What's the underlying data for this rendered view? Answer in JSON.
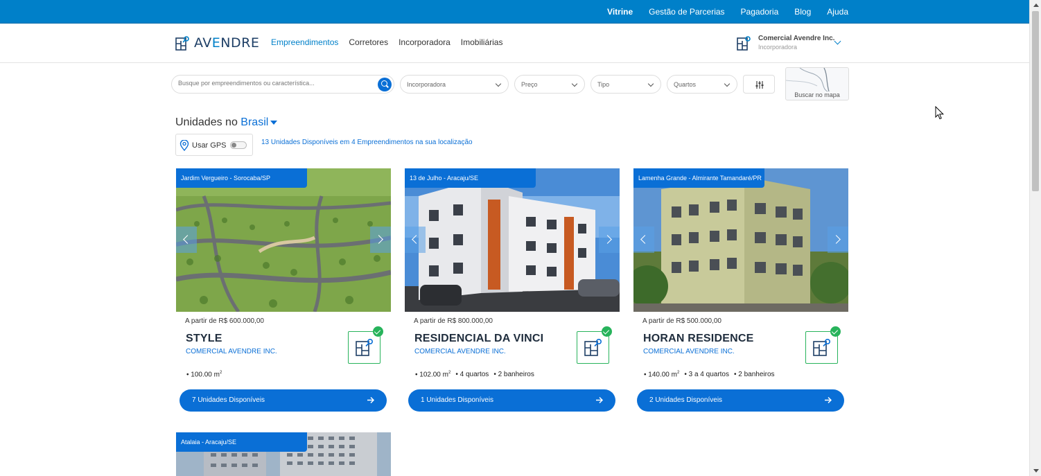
{
  "topbar": {
    "links": [
      {
        "label": "Vitrine",
        "bold": true
      },
      {
        "label": "Gestão de Parcerias",
        "bold": false
      },
      {
        "label": "Pagadoria",
        "bold": false
      },
      {
        "label": "Blog",
        "bold": false
      },
      {
        "label": "Ajuda",
        "bold": false
      }
    ]
  },
  "header": {
    "logo": {
      "part1": "AV",
      "part2": "E",
      "part3": "NDRE"
    },
    "nav": [
      "Empreendimentos",
      "Corretores",
      "Incorporadora",
      "Imobiliárias"
    ],
    "nav_active": 0,
    "account": {
      "name": "Comercial Avendre Inc.",
      "role": "Incorporadora"
    }
  },
  "search": {
    "placeholder": "Busque por empreendimentos ou característica...",
    "filters": [
      "Incorporadora",
      "Preço",
      "Tipo",
      "Quartos"
    ],
    "map_label": "Buscar no mapa"
  },
  "heading": {
    "prefix": "Unidades no",
    "location": "Brasil"
  },
  "gps": {
    "label": "Usar GPS",
    "enabled": false
  },
  "summary": "13 Unidades Disponíveis em 4 Empreendimentos na sua localização",
  "colors": {
    "topbar": "#0080c9",
    "accent": "#0a6fd6",
    "verified": "#27b35b"
  },
  "cards": [
    {
      "location": "Jardim Vergueiro - Sorocaba/SP",
      "price": "A partir de R$ 600.000,00",
      "name": "STYLE",
      "company": "COMERCIAL AVENDRE INC.",
      "area": "100.00 m",
      "rooms": "",
      "baths": "",
      "cta": "7 Unidades Disponíveis"
    },
    {
      "location": "13 de Julho - Aracaju/SE",
      "price": "A partir de R$ 800.000,00",
      "name": "RESIDENCIAL DA VINCI",
      "company": "COMERCIAL AVENDRE INC.",
      "area": "102.00 m",
      "rooms": "4 quartos",
      "baths": "2 banheiros",
      "cta": "1 Unidades Disponíveis"
    },
    {
      "location": "Lamenha Grande - Almirante Tamandaré/PR",
      "price": "A partir de R$ 500.000,00",
      "name": "HORAN RESIDENCE",
      "company": "COMERCIAL AVENDRE INC.",
      "area": "140.00 m",
      "rooms": "3 a 4 quartos",
      "baths": "2 banheiros",
      "cta": "2 Unidades Disponíveis"
    },
    {
      "location": "Atalaia - Aracaju/SE"
    }
  ]
}
